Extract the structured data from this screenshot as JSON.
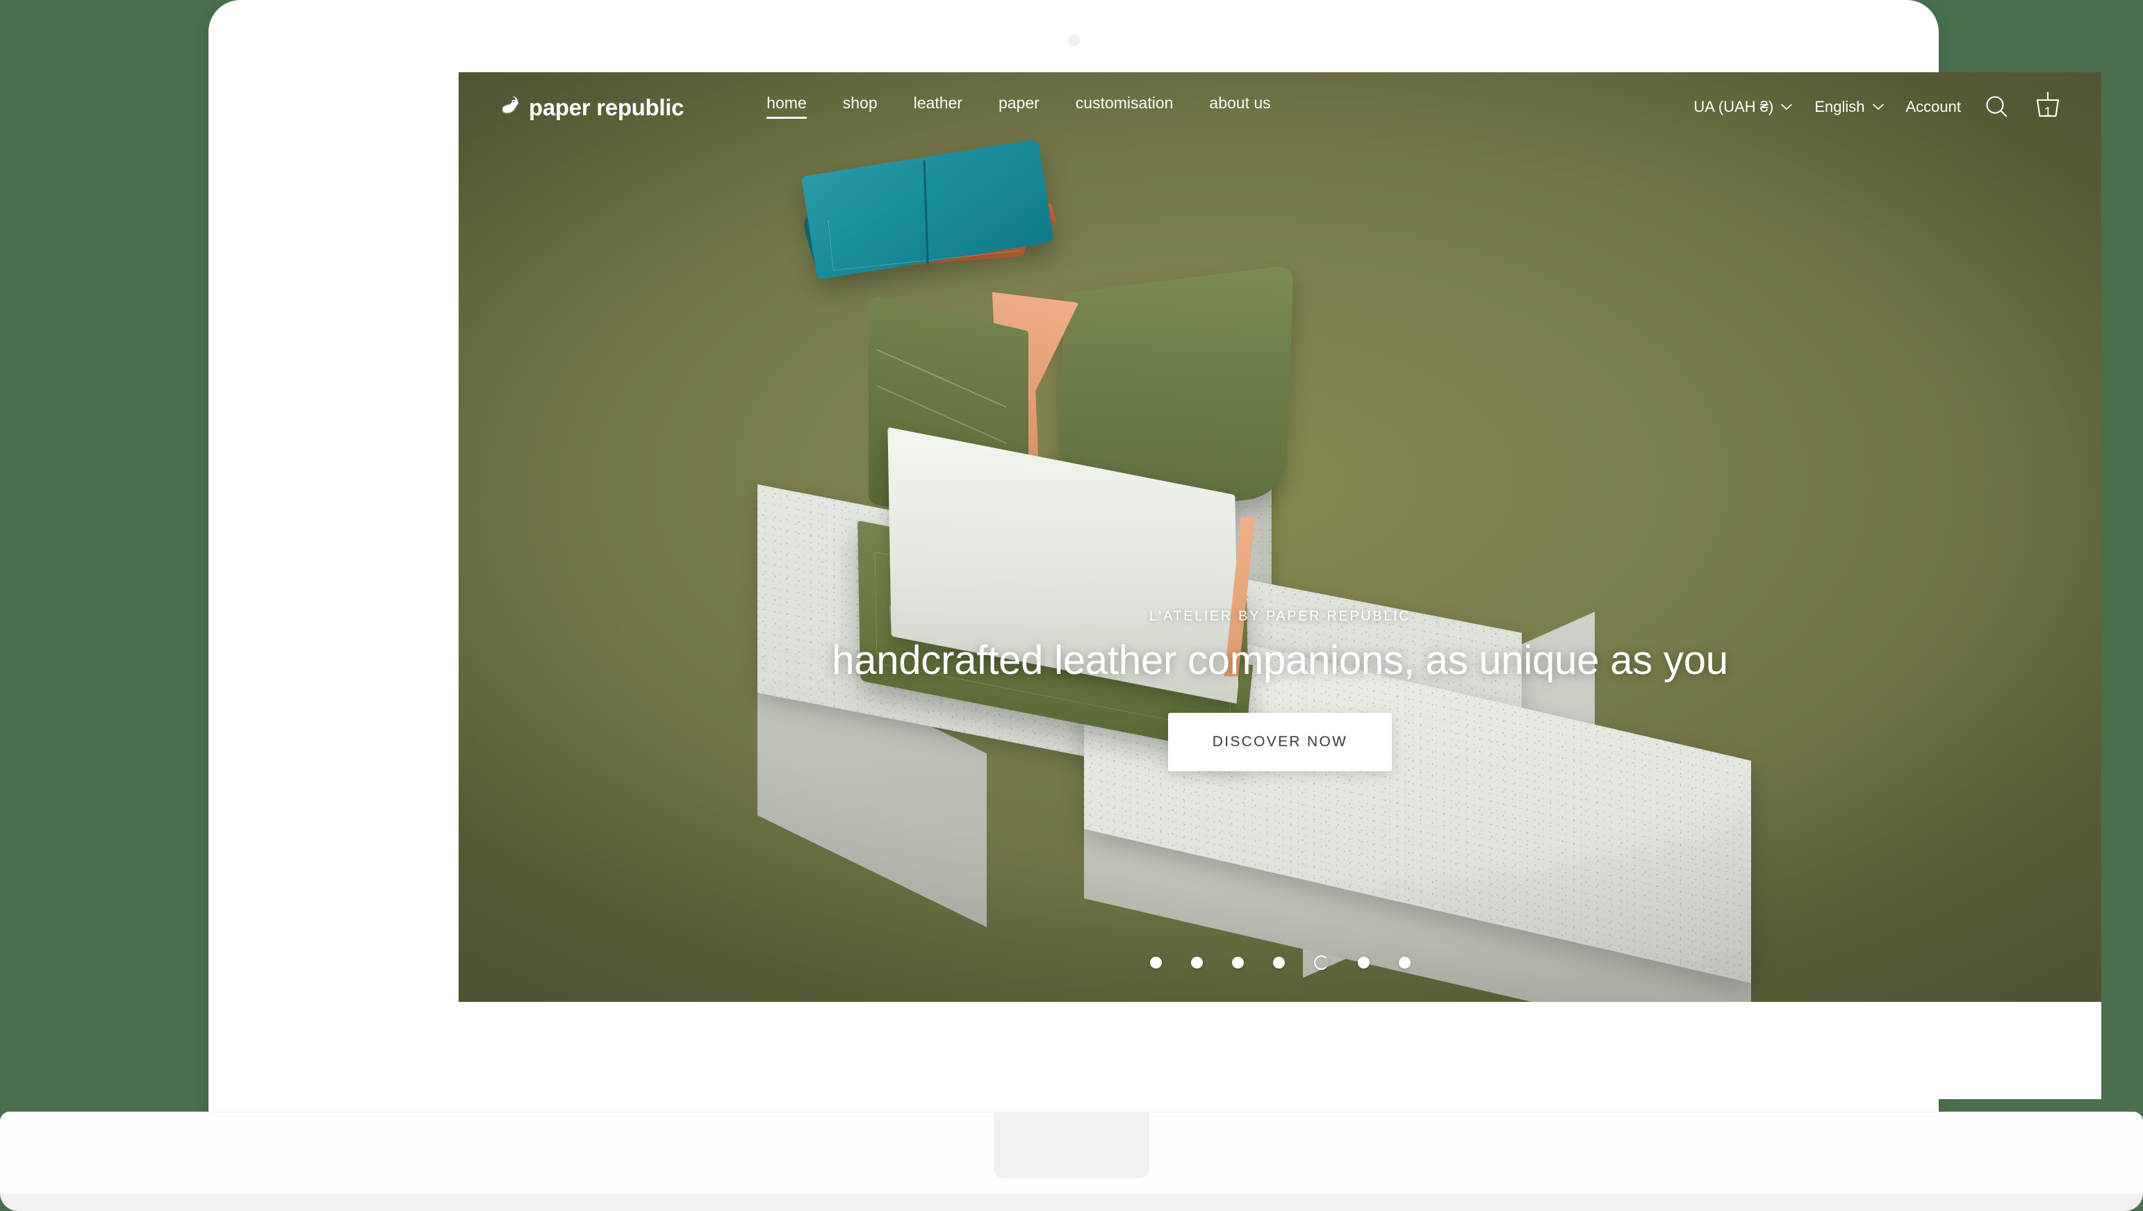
{
  "site": {
    "brand": {
      "name": "paper republic",
      "logo_icon": "horse-head-icon"
    },
    "nav": [
      {
        "label": "home",
        "active": true
      },
      {
        "label": "shop",
        "active": false
      },
      {
        "label": "leather",
        "active": false
      },
      {
        "label": "paper",
        "active": false
      },
      {
        "label": "customisation",
        "active": false
      },
      {
        "label": "about us",
        "active": false
      }
    ],
    "utilities": {
      "currency_label": "UA (UAH ₴)",
      "language_label": "English",
      "account_label": "Account",
      "search_icon": "search-icon",
      "cart_icon": "basket-icon",
      "cart_count": "1"
    }
  },
  "hero": {
    "eyebrow": "L'ATELIER BY PAPER REPUBLIC",
    "headline": "handcrafted leather companions, as unique as you",
    "cta_label": "DISCOVER NOW",
    "carousel": {
      "total_slides": 7,
      "active_slide": 5
    }
  },
  "colors": {
    "page_background": "#4a704d",
    "hero_background": "#7a7d4e",
    "accent_teal": "#1b8a96",
    "accent_olive": "#6d7c45",
    "accent_peach": "#e8a37c",
    "text_on_hero": "#ffffff",
    "cta_background": "#ffffff",
    "cta_text": "#3a3a36"
  }
}
